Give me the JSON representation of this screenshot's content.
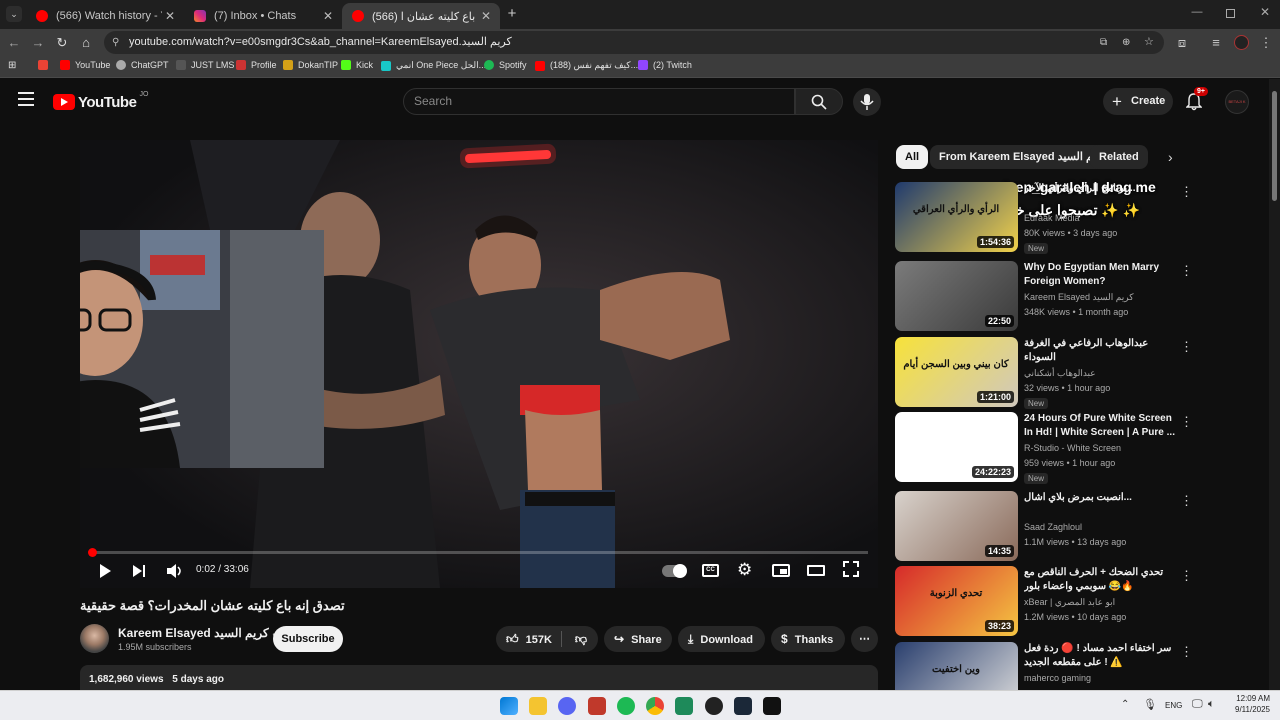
{
  "browser": {
    "tabs": [
      {
        "title": "(566) Watch history - YouTube",
        "active": false
      },
      {
        "title": "(7) Inbox • Chats",
        "active": false
      },
      {
        "title": "(566) تصدق إنه باع كليته عشان ا...",
        "active": true
      }
    ],
    "url": "youtube.com/watch?v=e00smgdr3Cs&ab_channel=KareemElsayed.كريم السيد",
    "bookmarks": [
      "YouTube",
      "ChatGPT",
      "JUST LMS",
      "Profile",
      "DokanTIP",
      "Kick",
      "انمي One Piece الحل...",
      "Spotify",
      "(188) كيف تفهم نفس...",
      "(2) Twitch"
    ]
  },
  "youtube": {
    "logo_text": "YouTube",
    "logo_region": "JO",
    "search_placeholder": "Search",
    "create_label": "Create",
    "notif_count": "9+",
    "avatar_text": "BETAJI K"
  },
  "player": {
    "time_current": "0:02",
    "time_total": "33:06",
    "time_display": "0:02 / 33:06",
    "progress": 0.001
  },
  "video": {
    "title": "تصدق إنه باع كليته عشان المخدرات؟ قصة حقيقية",
    "channel": "Kareem Elsayed كريم السيد",
    "subscribers": "1.95M subscribers",
    "subscribe_label": "Subscribe",
    "likes": "157K",
    "share_label": "Share",
    "download_label": "Download",
    "thanks_label": "Thanks",
    "views": "1,682,960 views",
    "age": "5 days ago"
  },
  "overlay": {
    "line1": "leen_garaleh | drag me",
    "line2": "تصبحوا على خير ✨ ✨"
  },
  "chips": [
    "All",
    "From Kareem Elsayed كريم السيد",
    "Related"
  ],
  "recommendations": [
    {
      "title": "برنامج الرأي والرأي الآخر...",
      "channel": "Edraak Media",
      "views": "80K views • 3 days ago",
      "duration": "1:54:36",
      "new": true,
      "thumb_text": "الرأي والرأي العراقي"
    },
    {
      "title": "Why Do Egyptian Men Marry Foreign Women?",
      "channel": "Kareem Elsayed كريم السيد",
      "views": "348K views • 1 month ago",
      "duration": "22:50",
      "new": false,
      "thumb_text": ""
    },
    {
      "title": "عبدالوهاب الرفاعي في الغرفة السوداء",
      "channel": "عبدالوهاب أشكناني",
      "views": "32 views • 1 hour ago",
      "duration": "1:21:00",
      "new": true,
      "thumb_text": "كان بيني وبين السجن أيام"
    },
    {
      "title": "24 Hours Of Pure White Screen In Hd! | White Screen | A Pure ...",
      "channel": "R-Studio - White Screen",
      "views": "959 views • 1 hour ago",
      "duration": "24:22:23",
      "new": true,
      "thumb_text": ""
    },
    {
      "title": "انصبت بمرض بلاي اشال...",
      "channel": "Saad Zaghloul",
      "views": "1.1M views • 13 days ago",
      "duration": "14:35",
      "new": false,
      "thumb_text": ""
    },
    {
      "title": "تحدي الضحك + الحرف الناقص مع سوبمي واعضاء بلور 😂🔥",
      "channel": "xBear | ابو عابد المصري",
      "views": "1.2M views • 10 days ago",
      "duration": "38:23",
      "new": false,
      "thumb_text": "تحدي الزنوبة"
    },
    {
      "title": "سر اختفاء احمد مساد ! 🔴 ردة فعل على مقطعه الجديد ! ⚠️",
      "channel": "maherco gaming",
      "views": "",
      "duration": "",
      "new": false,
      "thumb_text": "وين اختفيت"
    }
  ],
  "taskbar": {
    "lang": "ENG",
    "time": "12:09 AM",
    "date": "9/11/2025"
  },
  "colors": {
    "yt_red": "#ff0000",
    "bg": "#0f0f0f",
    "chip_bg": "#272727"
  }
}
